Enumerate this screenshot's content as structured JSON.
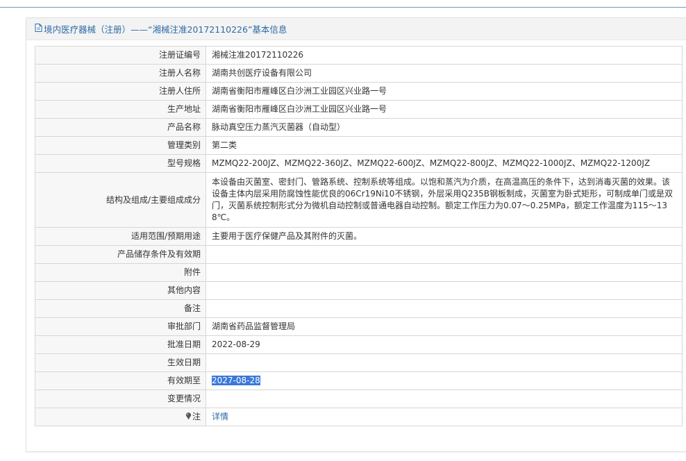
{
  "header": {
    "title": "境内医疗器械（注册）——“湘械注准20172110226”基本信息"
  },
  "icons": {
    "header": "document-icon",
    "note": "pin-icon"
  },
  "colors": {
    "accent": "#2c6aa6",
    "selection": "#3b78d8"
  },
  "rows": [
    {
      "label": "注册证编号",
      "value": "湘械注准20172110226"
    },
    {
      "label": "注册人名称",
      "value": "湖南共创医疗设备有限公司"
    },
    {
      "label": "注册人住所",
      "value": "湖南省衡阳市雁峰区白沙洲工业园区兴业路一号"
    },
    {
      "label": "生产地址",
      "value": "湖南省衡阳市雁峰区白沙洲工业园区兴业路一号"
    },
    {
      "label": "产品名称",
      "value": "脉动真空压力蒸汽灭菌器（自动型）"
    },
    {
      "label": "管理类别",
      "value": "第二类"
    },
    {
      "label": "型号规格",
      "value": "MZMQ22-200JZ、MZMQ22-360JZ、MZMQ22-600JZ、MZMQ22-800JZ、MZMQ22-1000JZ、MZMQ22-1200JZ"
    },
    {
      "label": "结构及组成/主要组成成分",
      "value": "本设备由灭菌室、密封门、管路系统、控制系统等组成。以饱和蒸汽为介质，在高温高压的条件下，达到消毒灭菌的效果。该设备主体内层采用防腐蚀性能优良的06Cr19Ni10不锈钢，外层采用Q235B钢板制成，灭菌室为卧式矩形，可制成单门或是双门，灭菌系统控制形式分为微机自动控制或普通电器自动控制。额定工作压力为0.07～0.25MPa，额定工作温度为115～138℃。"
    },
    {
      "label": "适用范围/预期用途",
      "value": "主要用于医疗保健产品及其附件的灭菌。"
    },
    {
      "label": "产品储存条件及有效期",
      "value": ""
    },
    {
      "label": "附件",
      "value": ""
    },
    {
      "label": "其他内容",
      "value": ""
    },
    {
      "label": "备注",
      "value": ""
    },
    {
      "label": "审批部门",
      "value": "湖南省药品监督管理局"
    },
    {
      "label": "批准日期",
      "value": "2022-08-29"
    },
    {
      "label": "生效日期",
      "value": ""
    },
    {
      "label": "有效期至",
      "value": "2027-08-28"
    },
    {
      "label": "变更情况",
      "value": ""
    },
    {
      "label": "注",
      "value": "详情"
    }
  ]
}
